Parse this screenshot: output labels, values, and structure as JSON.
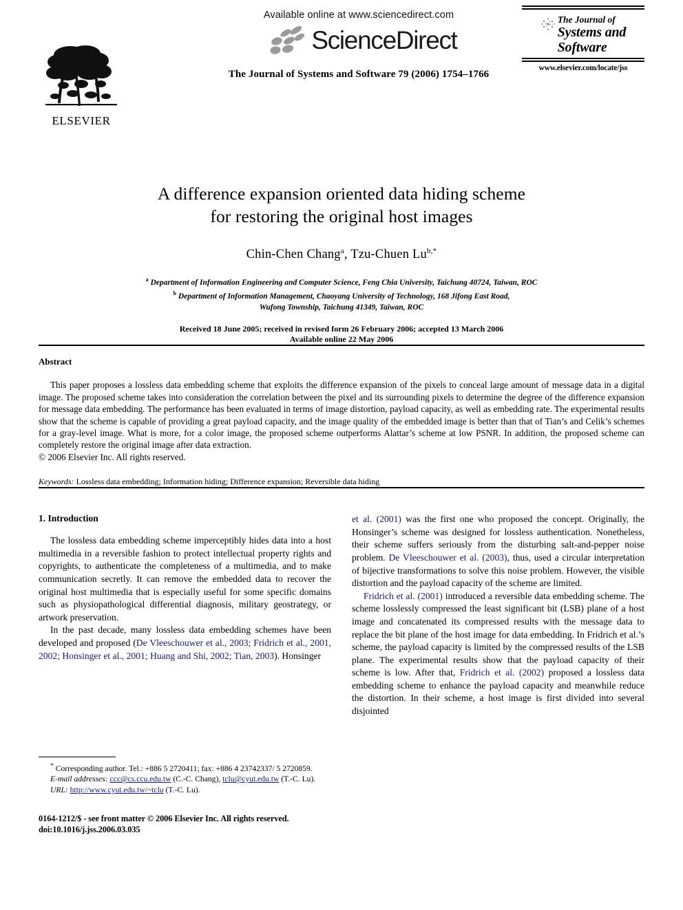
{
  "masthead": {
    "publisher_name": "ELSEVIER",
    "publisher_logo_icon": "elsevier-tree-logo",
    "available_online": "Available online at www.sciencedirect.com",
    "sciencedirect_wordmark": "ScienceDirect",
    "sciencedirect_logo_icon": "sciencedirect-petals-icon",
    "journal_citation": "The Journal of Systems and Software 79 (2006) 1754–1766",
    "journal_box": {
      "globe_icon": "journal-globe-icon",
      "line1": "The Journal of",
      "line2": "Systems and",
      "line3": "Software",
      "url": "www.elsevier.com/locate/jss"
    }
  },
  "title_block": {
    "title_line1": "A difference expansion oriented data hiding scheme",
    "title_line2": "for restoring the original host images",
    "authors": {
      "author1_name": "Chin-Chen Chang",
      "author1_sup": "a",
      "separator": ", ",
      "author2_name": "Tzu-Chuen Lu",
      "author2_sup": "b,*"
    },
    "affiliation_a_sup": "a",
    "affiliation_a": "Department of Information Engineering and Computer Science, Feng Chia University, Taichung 40724, Taiwan, ROC",
    "affiliation_b_sup": "b",
    "affiliation_b_line1": "Department of Information Management, Chaoyang University of Technology, 168 Jifong East Road,",
    "affiliation_b_line2": "Wufong Township, Taichung 41349, Taiwan, ROC",
    "dates_line1": "Received 18 June 2005; received in revised form 26 February 2006; accepted 13 March 2006",
    "dates_line2": "Available online 22 May 2006"
  },
  "abstract": {
    "heading": "Abstract",
    "text": "This paper proposes a lossless data embedding scheme that exploits the difference expansion of the pixels to conceal large amount of message data in a digital image. The proposed scheme takes into consideration the correlation between the pixel and its surrounding pixels to determine the degree of the difference expansion for message data embedding. The performance has been evaluated in terms of image distortion, payload capacity, as well as embedding rate. The experimental results show that the scheme is capable of providing a great payload capacity, and the image quality of the embedded image is better than that of Tian’s and Celik’s schemes for a gray-level image. What is more, for a color image, the proposed scheme outperforms Alattar’s scheme at low PSNR. In addition, the proposed scheme can completely restore the original image after data extraction.",
    "copyright": "© 2006 Elsevier Inc. All rights reserved.",
    "keywords_label": "Keywords:",
    "keywords_value": "Lossless data embedding; Information hiding; Difference expansion; Reversible data hiding"
  },
  "body": {
    "section1_heading": "1. Introduction",
    "left_col": {
      "para1": "The lossless data embedding scheme imperceptibly hides data into a host multimedia in a reversible fashion to protect intellectual property rights and copyrights, to authenticate the completeness of a multimedia, and to make communication secretly. It can remove the embedded data to recover the original host multimedia that is especially useful for some specific domains such as physiopathological differential diagnosis, military geostrategy, or artwork preservation.",
      "para2_pre": "In the past decade, many lossless data embedding schemes have been developed and proposed (",
      "para2_cite": "De Vleeschouwer et al., 2003; Fridrich et al., 2001, 2002; Honsinger et al., 2001; Huang and Shi, 2002; Tian, 2003",
      "para2_post": "). Honsinger"
    },
    "right_col": {
      "para2_cont_cite": "et al. (2001)",
      "para2_cont": " was the first one who proposed the concept. Originally, the Honsinger’s scheme was designed for lossless authentication. Nonetheless, their scheme suffers seriously from the disturbing salt-and-pepper noise problem. ",
      "para3_cite": "De Vleeschouwer et al. (2003)",
      "para3_post": ", thus, used a circular interpretation of bijective transformations to solve this noise problem. However, the visible distortion and the payload capacity of the scheme are limited.",
      "para4_cite": "Fridrich et al. (2001)",
      "para4_mid": " introduced a reversible data embedding scheme. The scheme losslessly compressed the least significant bit (LSB) plane of a host image and concatenated its compressed results with the message data to replace the bit plane of the host image for data embedding. In Fridrich et al.’s scheme, the payload capacity is limited by the compressed results of the LSB plane. The experimental results show that the payload capacity of their scheme is low. After that, ",
      "para4_cite2": "Fridrich et al. (2002)",
      "para4_post": " proposed a lossless data embedding scheme to enhance the payload capacity and meanwhile reduce the distortion. In their scheme, a host image is first divided into several disjointed"
    }
  },
  "footnote": {
    "marker": "*",
    "corresponding": "Corresponding author. Tel.: +886 5 2720411; fax: +886 4 23742337/ 5 2720859.",
    "email_label": "E-mail addresses:",
    "email1": "ccc@cs.ccu.edu.tw",
    "email1_owner": " (C.-C. Chang), ",
    "email2": "tclu@cyut.edu.tw",
    "email2_owner": " (T.-C. Lu).",
    "url_label": "URL:",
    "url_value": "http://www.cyut.edu.tw/~tclu",
    "url_owner": " (T.-C. Lu)."
  },
  "footer": {
    "issn_line": "0164-1212/$ - see front matter © 2006 Elsevier Inc. All rights reserved.",
    "doi_line": "doi:10.1016/j.jss.2006.03.035"
  },
  "colors": {
    "citation_link": "#1a1a6e",
    "text": "#000000",
    "sciencedirect_petal": "#9b9b9b",
    "background": "#ffffff"
  }
}
